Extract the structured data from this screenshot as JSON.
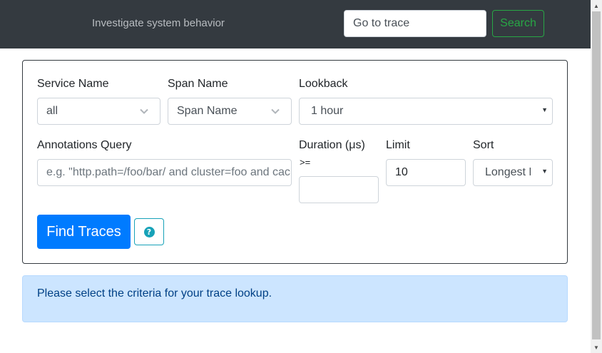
{
  "header": {
    "tagline": "Investigate system behavior",
    "goto_placeholder": "Go to trace",
    "search_label": "Search"
  },
  "form": {
    "service_name": {
      "label": "Service Name",
      "value": "all"
    },
    "span_name": {
      "label": "Span Name",
      "value": "Span Name"
    },
    "lookback": {
      "label": "Lookback",
      "value": "1 hour"
    },
    "annotations": {
      "label": "Annotations Query",
      "placeholder": "e.g. \"http.path=/foo/bar/ and cluster=foo and cache.miss\""
    },
    "duration": {
      "label": "Duration (μs)",
      "operator": ">=",
      "value": ""
    },
    "limit": {
      "label": "Limit",
      "value": "10"
    },
    "sort": {
      "label": "Sort",
      "value": "Longest First"
    },
    "find_label": "Find Traces",
    "help_glyph": "?"
  },
  "alert": {
    "text": "Please select the criteria for your trace lookup."
  },
  "icons": {
    "dropdown": "chevron-down-icon",
    "help": "question-circle-icon",
    "select_caret": "caret-down-icon"
  },
  "colors": {
    "header_bg": "#343a40",
    "search_accent": "#28a745",
    "primary": "#007bff",
    "info": "#17a2b8",
    "alert_bg": "#cce5ff",
    "alert_text": "#004085"
  }
}
